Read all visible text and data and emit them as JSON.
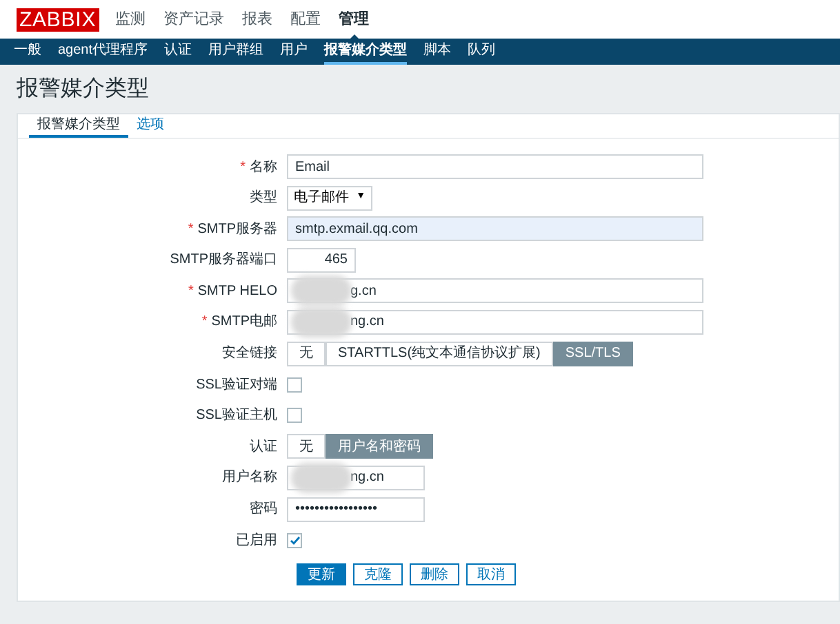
{
  "header": {
    "logo": "ZABBIX",
    "menu": [
      {
        "label": "监测",
        "selected": false
      },
      {
        "label": "资产记录",
        "selected": false
      },
      {
        "label": "报表",
        "selected": false
      },
      {
        "label": "配置",
        "selected": false
      },
      {
        "label": "管理",
        "selected": true
      }
    ]
  },
  "submenu": [
    {
      "label": "一般",
      "selected": false
    },
    {
      "label": "agent代理程序",
      "selected": false
    },
    {
      "label": "认证",
      "selected": false
    },
    {
      "label": "用户群组",
      "selected": false
    },
    {
      "label": "用户",
      "selected": false
    },
    {
      "label": "报警媒介类型",
      "selected": true
    },
    {
      "label": "脚本",
      "selected": false
    },
    {
      "label": "队列",
      "selected": false
    }
  ],
  "page_title": "报警媒介类型",
  "tabs": [
    {
      "label": "报警媒介类型",
      "selected": true
    },
    {
      "label": "选项",
      "selected": false
    }
  ],
  "form": {
    "rows": [
      {
        "kind": "text",
        "label": "名称",
        "required_mark": "*",
        "value": "Email",
        "focused": false
      },
      {
        "kind": "select",
        "label": "类型",
        "value": "电子邮件",
        "arrow": "▼"
      },
      {
        "kind": "text",
        "label": "SMTP服务器",
        "required_mark": "*",
        "value": "smtp.exmail.qq.com",
        "focused": true
      },
      {
        "kind": "number",
        "label": "SMTP服务器端口",
        "value": "465",
        "focused": false
      },
      {
        "kind": "text",
        "label": "SMTP HELO",
        "required_mark": "*",
        "value": "g.cn",
        "focused": false,
        "redacted": true
      },
      {
        "kind": "text",
        "label": "SMTP电邮",
        "required_mark": "*",
        "value": "ng.cn",
        "focused": false,
        "redacted": true
      },
      {
        "kind": "segmented",
        "label": "安全链接",
        "options": [
          {
            "label": "无",
            "selected": false
          },
          {
            "label": "STARTTLS(纯文本通信协议扩展)",
            "selected": false
          },
          {
            "label": "SSL/TLS",
            "selected": true
          }
        ]
      },
      {
        "kind": "checkbox",
        "label": "SSL验证对端",
        "checked": false
      },
      {
        "kind": "checkbox",
        "label": "SSL验证主机",
        "checked": false
      },
      {
        "kind": "segmented",
        "label": "认证",
        "options": [
          {
            "label": "无",
            "selected": false
          },
          {
            "label": "用户名和密码",
            "selected": true
          }
        ]
      },
      {
        "kind": "short",
        "label": "用户名称",
        "value": "ng.cn",
        "focused": false,
        "redacted": true
      },
      {
        "kind": "short",
        "label": "密码",
        "value": "•••••••••••••••••",
        "focused": false
      },
      {
        "kind": "checkbox",
        "label": "已启用",
        "checked": true
      }
    ],
    "buttons": [
      {
        "label": "更新",
        "kind": "primary"
      },
      {
        "label": "克隆",
        "kind": "secondary"
      },
      {
        "label": "删除",
        "kind": "secondary"
      },
      {
        "label": "取消",
        "kind": "secondary"
      }
    ]
  }
}
